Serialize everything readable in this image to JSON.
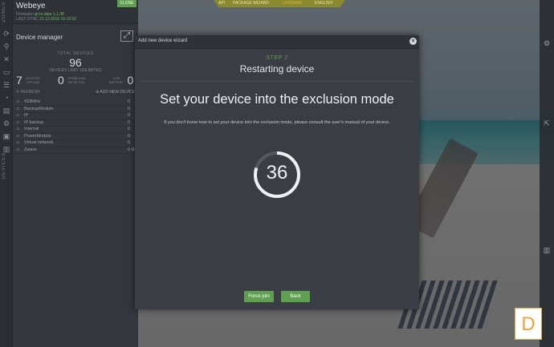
{
  "app": {
    "name": "Webeye",
    "close_label": "CLOSE",
    "firmware_prefix": "Firmware",
    "firmware": "up to date 1.1.38",
    "last_sync_prefix": "LAST SYNC",
    "last_sync": "21.12.2016 16:10:52"
  },
  "rail": {
    "top_label": "ZONES",
    "bottom_label": "DEVICES"
  },
  "topmenu": {
    "items": [
      "API",
      "PACKAGE WIZARD",
      "UPGRADE",
      "ENGLISH"
    ]
  },
  "device_manager": {
    "title": "Device manager",
    "total_label": "TOTAL DEVICES",
    "total": "96",
    "limit": "DEVICES LIMIT: UNLIMITED",
    "stats": [
      {
        "n": "7",
        "l1": "DEVICES",
        "l2": "OFFLINE"
      },
      {
        "n": "0",
        "l1": "PROBLEMS",
        "l2": "DETECTED"
      },
      {
        "n": "0",
        "l1": "LOW",
        "l2": "BATTERY"
      }
    ],
    "filter": "REFRESH",
    "add_device": "ADD NEW DEVICE",
    "devices": [
      {
        "name": "433MHz",
        "count": "0"
      },
      {
        "name": "BackupModule",
        "count": "0"
      },
      {
        "name": "IP",
        "count": "0"
      },
      {
        "name": "IP backup",
        "count": "0"
      },
      {
        "name": "Internal",
        "count": "0"
      },
      {
        "name": "PowerModule",
        "count": "0"
      },
      {
        "name": "Virtual network",
        "count": "0"
      },
      {
        "name": "Zwave",
        "count": "0"
      }
    ]
  },
  "modal": {
    "title": "Add new device wizard",
    "step_label": "STEP 2",
    "step_title": "Restarting device",
    "headline": "Set your device into the exclusion mode",
    "description": "If you don't know how to set your device into the exclusion mode, please consult the user's manual of your device.",
    "countdown": "36",
    "countdown_fraction_remaining": 0.8,
    "buttons": {
      "force_join": "Force join",
      "back": "Back"
    }
  },
  "colors": {
    "accent_green": "#5ea04f",
    "panel_bg": "#33363c",
    "modal_bg": "#3a3d43"
  },
  "icons": [
    "refresh-icon",
    "search-icon",
    "close-icon",
    "folder-icon",
    "trash-icon",
    "expand-icon",
    "gear-icon",
    "external-link-icon",
    "logo-d"
  ]
}
